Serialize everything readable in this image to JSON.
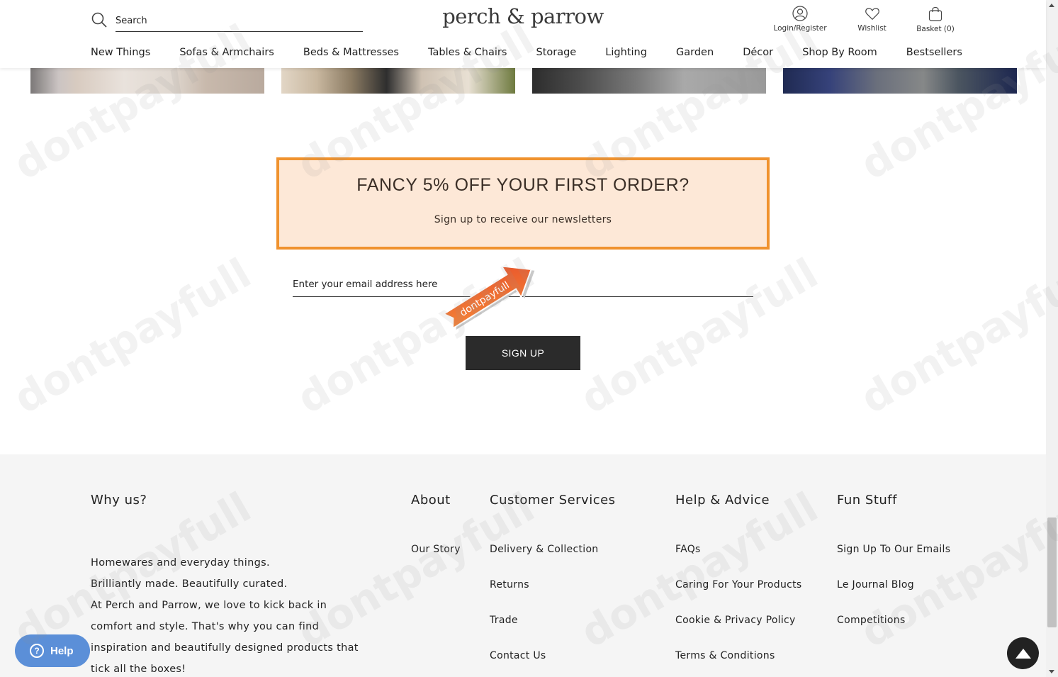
{
  "header": {
    "search_placeholder": "Search",
    "logo": "perch & parrow",
    "login_label": "Login/Register",
    "wishlist_label": "Wishlist",
    "basket_label": "Basket (0)"
  },
  "nav": [
    "New Things",
    "Sofas & Armchairs",
    "Beds & Mattresses",
    "Tables & Chairs",
    "Storage",
    "Lighting",
    "Garden",
    "Décor",
    "Shop By Room",
    "Bestsellers"
  ],
  "promo": {
    "title": "FANCY 5% OFF YOUR FIRST ORDER?",
    "subtitle": "Sign up to receive our newsletters",
    "email_placeholder": "Enter your email address here",
    "button": "SIGN UP",
    "arrow_label": "dontpayfull"
  },
  "footer": {
    "why": {
      "heading": "Why us?",
      "lines": [
        "Homewares and everyday things.",
        "Brilliantly made. Beautifully curated.",
        "At Perch and Parrow, we love to kick back in",
        "comfort and style. That's why you can find",
        "inspiration and beautifully designed products that",
        "tick all the boxes!"
      ]
    },
    "about": {
      "heading": "About",
      "links": [
        "Our Story"
      ]
    },
    "customer": {
      "heading": "Customer Services",
      "links": [
        "Delivery & Collection",
        "Returns",
        "Trade",
        "Contact Us"
      ]
    },
    "help": {
      "heading": "Help & Advice",
      "links": [
        "FAQs",
        "Caring For Your Products",
        "Cookie & Privacy Policy",
        "Terms & Conditions"
      ]
    },
    "fun": {
      "heading": "Fun Stuff",
      "links": [
        "Sign Up To Our Emails",
        "Le Journal Blog",
        "Competitions"
      ]
    }
  },
  "floating": {
    "help_label": "Help"
  },
  "watermark": "dontpayfull",
  "colors": {
    "promo_bg": "#fde8d7",
    "promo_border": "#f0922e",
    "button_bg": "#2b2b2b",
    "help_bg": "#5b8fd8",
    "footer_bg": "#f5f5f5"
  }
}
